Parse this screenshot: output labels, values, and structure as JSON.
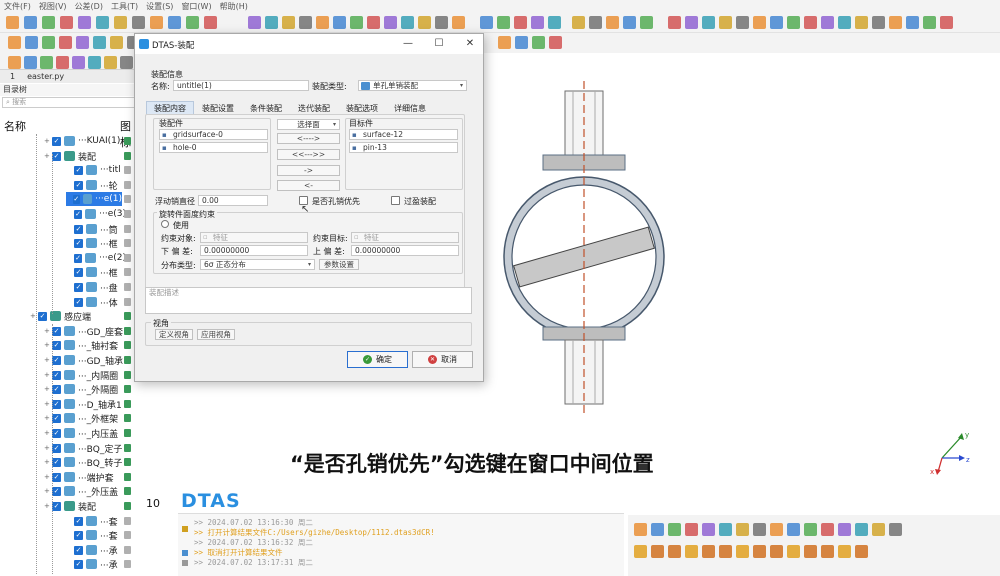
{
  "menu": [
    "文件(F)",
    "视图(V)",
    "公差(D)",
    "工具(T)",
    "设置(S)",
    "窗口(W)",
    "帮助(H)"
  ],
  "doc_tab": {
    "index": "1",
    "filename": "easter.py"
  },
  "tree_panel": {
    "title": "目录树",
    "search_placeholder": "搜索",
    "col_name": "名称",
    "col_icon": "图标",
    "rows": [
      {
        "label": "···KUAI(1)",
        "chk": false,
        "indent": 44
      },
      {
        "label": "装配",
        "chk": false,
        "indent": 44
      },
      {
        "label": "···titl",
        "chk": true,
        "indent": 66
      },
      {
        "label": "···轮",
        "chk": true,
        "indent": 66
      },
      {
        "label": "···e(1)",
        "chk": true,
        "indent": 66,
        "selected": true
      },
      {
        "label": "···e(3)",
        "chk": true,
        "indent": 66
      },
      {
        "label": "···筒",
        "chk": true,
        "indent": 66
      },
      {
        "label": "···框",
        "chk": true,
        "indent": 66
      },
      {
        "label": "···e(2)",
        "chk": true,
        "indent": 66
      },
      {
        "label": "···框",
        "chk": true,
        "indent": 66
      },
      {
        "label": "···盘",
        "chk": true,
        "indent": 66
      },
      {
        "label": "···体",
        "chk": true,
        "indent": 66
      },
      {
        "label": "感应端",
        "chk": false,
        "indent": 30
      },
      {
        "label": "···GD_座套",
        "chk": false,
        "indent": 44
      },
      {
        "label": "···_轴衬套",
        "chk": false,
        "indent": 44
      },
      {
        "label": "···GD_轴承",
        "chk": false,
        "indent": 44
      },
      {
        "label": "···_内隔圈",
        "chk": false,
        "indent": 44
      },
      {
        "label": "···_外隔圈",
        "chk": false,
        "indent": 44
      },
      {
        "label": "···D_轴承1",
        "chk": false,
        "indent": 44
      },
      {
        "label": "···_外框架",
        "chk": false,
        "indent": 44
      },
      {
        "label": "···_内压盖",
        "chk": false,
        "indent": 44
      },
      {
        "label": "···BQ_定子",
        "chk": false,
        "indent": 44
      },
      {
        "label": "···BQ_转子",
        "chk": false,
        "indent": 44
      },
      {
        "label": "···端护套",
        "chk": false,
        "indent": 44
      },
      {
        "label": "···_外压盖",
        "chk": false,
        "indent": 44
      },
      {
        "label": "装配",
        "chk": false,
        "indent": 44
      },
      {
        "label": "···套",
        "chk": true,
        "indent": 66
      },
      {
        "label": "···套",
        "chk": true,
        "indent": 66
      },
      {
        "label": "···承",
        "chk": true,
        "indent": 66
      },
      {
        "label": "···承",
        "chk": true,
        "indent": 66
      }
    ],
    "number": "10"
  },
  "dialog": {
    "title": "DTAS-装配",
    "info_group": "装配信息",
    "name_label": "名称:",
    "name_value": "untitle(1)",
    "type_label": "装配类型:",
    "type_value": "单孔单销装配",
    "tabs": [
      "装配内容",
      "装配设置",
      "条件装配",
      "迭代装配",
      "装配选项",
      "详细信息"
    ],
    "parts_group": "装配件",
    "parts": [
      "gridsurface-0",
      "hole-0"
    ],
    "select_face": "选择面",
    "arrow_buttons": [
      "<---->",
      "<<--->>",
      "->",
      "<-"
    ],
    "target_group": "目标件",
    "targets": [
      "surface-12",
      "pin-13"
    ],
    "float_label": "浮动销直径",
    "float_value": "0.00",
    "hole_first_label": "是否孔销优先",
    "overfill_label": "过盈装配",
    "rotation_group": "旋转件面度约束",
    "use_label": "使用",
    "constraint_obj_label": "约束对象:",
    "constraint_obj_value": "特征",
    "constraint_target_label": "约束目标:",
    "constraint_target_value": "特征",
    "lower_label": "下 偏 差:",
    "lower_value": "0.00000000",
    "upper_label": "上 偏 差:",
    "upper_value": "0.00000000",
    "dist_label": "分布类型:",
    "dist_value": "6σ 正态分布",
    "param_button": "参数设置",
    "desc_placeholder": "装配描述",
    "view_group": "视角",
    "define_view": "定义视角",
    "apply_view": "应用视角",
    "ok": "确定",
    "cancel": "取消"
  },
  "console_lines": [
    {
      "text": ">>  2024.07.02  13:16:30  周二",
      "hl": false
    },
    {
      "text": ">>  打开计算结果文件C:/Users/gizhe/Desktop/1112.dtas3dCR!",
      "hl": true
    },
    {
      "text": ">>  2024.07.02  13:16:32  周二",
      "hl": false
    },
    {
      "text": ">>  取消打开计算结果文件",
      "hl": true
    },
    {
      "text": ">>  2024.07.02  13:17:31  周二",
      "hl": false
    }
  ],
  "logo_text": "DTAS",
  "caption": "“是否孔销优先”勾选键在窗口中间位置",
  "axis": {
    "x": "x",
    "y": "y",
    "z": "z"
  }
}
